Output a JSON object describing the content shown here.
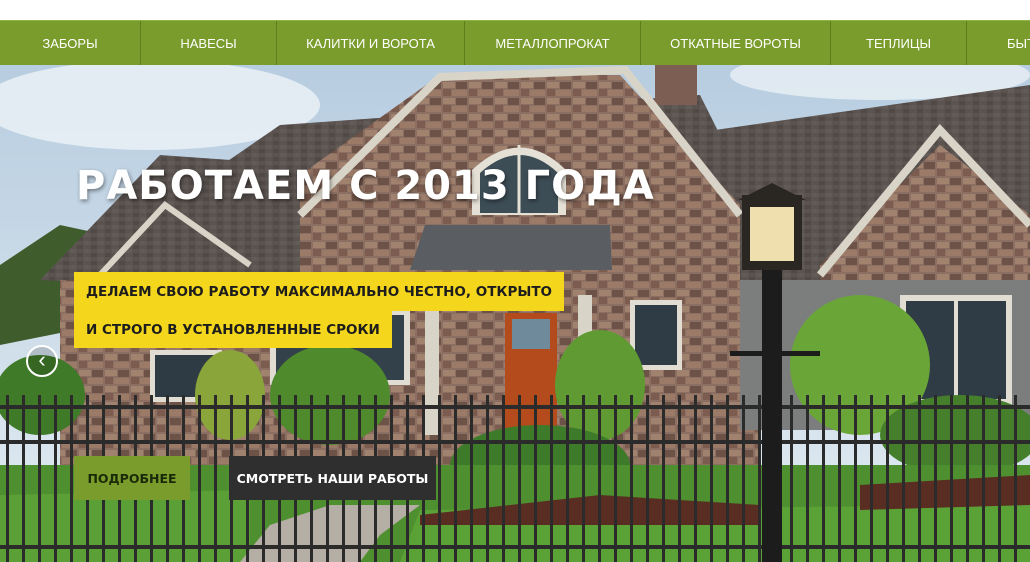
{
  "nav": {
    "items": [
      {
        "label": "ЗАБОРЫ"
      },
      {
        "label": "НАВЕСЫ"
      },
      {
        "label": "КАЛИТКИ И ВОРОТА"
      },
      {
        "label": "МЕТАЛЛОПРОКАТ"
      },
      {
        "label": "ОТКАТНЫЕ ВОРОТЫ"
      },
      {
        "label": "ТЕПЛИЦЫ"
      },
      {
        "label": "БЫТ"
      }
    ]
  },
  "hero": {
    "title": "РАБОТАЕМ С 2013 ГОДА",
    "tagline_line1": "ДЕЛАЕМ СВОЮ РАБОТУ МАКСИМАЛЬНО ЧЕСТНО, ОТКРЫТО",
    "tagline_line2": "И СТРОГО В УСТАНОВЛЕННЫЕ СРОКИ",
    "prev_arrow": "‹",
    "button_more": "ПОДРОБНЕЕ",
    "button_works": "СМОТРЕТЬ НАШИ РАБОТЫ"
  },
  "colors": {
    "nav_bg": "#7a9c2c",
    "tag_bg": "#f4d61c",
    "button_dark": "#2f2f2f"
  }
}
